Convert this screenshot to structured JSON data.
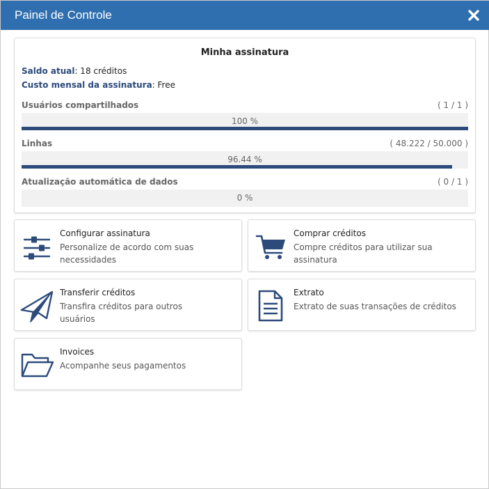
{
  "window": {
    "title": "Painel de Controle"
  },
  "subscription": {
    "title": "Minha assinatura",
    "balance_label": "Saldo atual",
    "balance_value": ": 18 créditos",
    "monthly_label": "Custo mensal da assinatura",
    "monthly_value": ": Free",
    "rows": [
      {
        "label": "Usuários compartilhados",
        "count": "( 1 / 1 )",
        "percent_text": "100 %",
        "fill_fraction": 1.0
      },
      {
        "label": "Linhas",
        "count": "( 48.222 / 50.000 )",
        "percent_text": "96.44 %",
        "fill_fraction": 0.9644
      },
      {
        "label": "Atualização automática de dados",
        "count": "( 0 / 1 )",
        "percent_text": "0 %",
        "fill_fraction": 0.0
      }
    ]
  },
  "tiles": [
    {
      "name": "configure",
      "icon": "sliders-icon",
      "title": "Configurar assinatura",
      "desc": "Personalize de acordo com suas necessidades"
    },
    {
      "name": "buy",
      "icon": "cart-icon",
      "title": "Comprar créditos",
      "desc": "Compre créditos para utilizar sua assinatura"
    },
    {
      "name": "transfer",
      "icon": "paper-plane-icon",
      "title": "Transferir créditos",
      "desc": "Transfira créditos para outros usuários"
    },
    {
      "name": "statement",
      "icon": "document-icon",
      "title": "Extrato",
      "desc": "Extrato de suas transações de créditos"
    },
    {
      "name": "invoices",
      "icon": "folder-open-icon",
      "title": "Invoices",
      "desc": "Acompanhe seus pagamentos"
    }
  ],
  "colors": {
    "titlebar": "#2f6faf",
    "accent": "#2c4a7a",
    "bar_track": "#f1f1f1"
  }
}
